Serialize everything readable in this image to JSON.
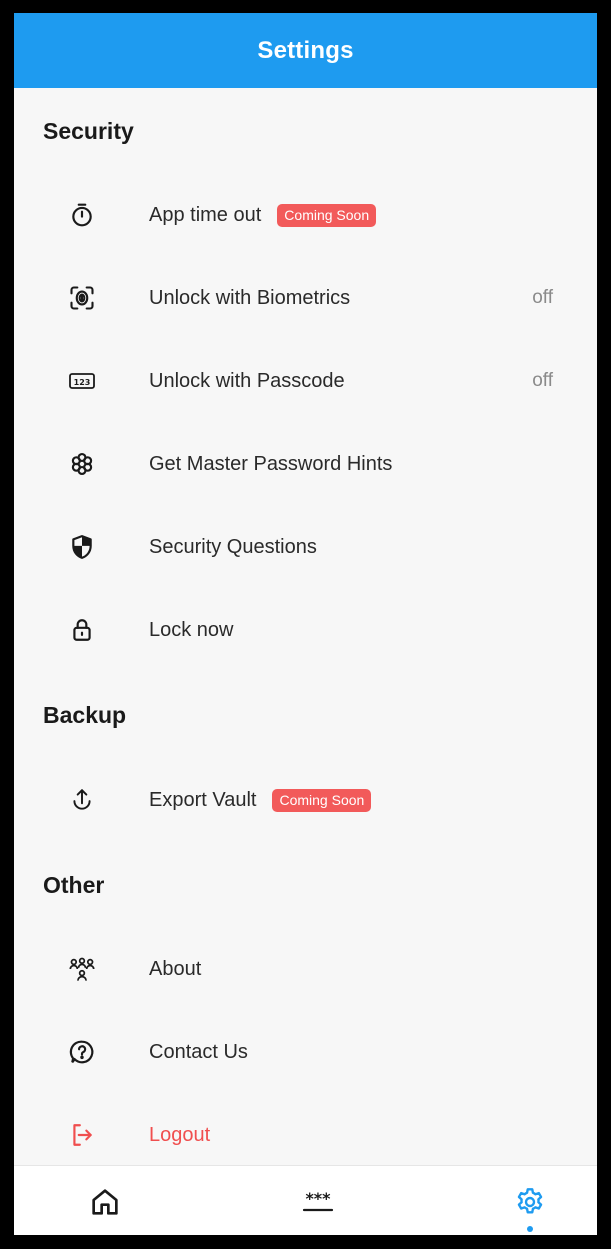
{
  "header": {
    "title": "Settings"
  },
  "sections": {
    "security": {
      "title": "Security",
      "items": [
        {
          "label": "App time out",
          "badge": "Coming Soon",
          "icon": "stopwatch-icon"
        },
        {
          "label": "Unlock with Biometrics",
          "value": "off",
          "icon": "fingerprint-icon"
        },
        {
          "label": "Unlock with Passcode",
          "value": "off",
          "icon": "passcode-icon"
        },
        {
          "label": "Get Master Password Hints",
          "icon": "hints-icon"
        },
        {
          "label": "Security Questions",
          "icon": "shield-icon"
        },
        {
          "label": "Lock now",
          "icon": "lock-icon"
        }
      ]
    },
    "backup": {
      "title": "Backup",
      "items": [
        {
          "label": "Export Vault",
          "badge": "Coming Soon",
          "icon": "upload-icon"
        }
      ]
    },
    "other": {
      "title": "Other",
      "items": [
        {
          "label": "About",
          "icon": "people-icon"
        },
        {
          "label": "Contact Us",
          "icon": "help-icon"
        },
        {
          "label": "Logout",
          "icon": "logout-icon"
        }
      ]
    }
  },
  "bottom_nav": {
    "items": [
      {
        "name": "home",
        "icon": "home-icon"
      },
      {
        "name": "passwords",
        "icon": "password-icon"
      },
      {
        "name": "settings",
        "icon": "gear-icon",
        "active": true
      }
    ],
    "active_color": "#1e9bf0"
  },
  "colors": {
    "header": "#1e9bf0",
    "badge": "#f25a5a",
    "logout": "#f04e4e"
  }
}
